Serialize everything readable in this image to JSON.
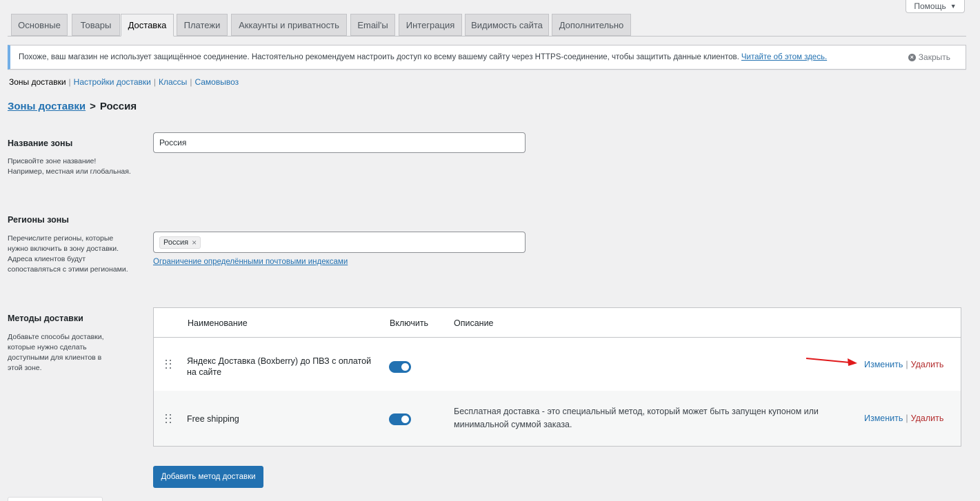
{
  "help": {
    "label": "Помощь",
    "caret": "▼"
  },
  "tabs": [
    {
      "label": "Основные"
    },
    {
      "label": "Товары"
    },
    {
      "label": "Доставка"
    },
    {
      "label": "Платежи"
    },
    {
      "label": "Аккаунты и приватность"
    },
    {
      "label": "Email'ы"
    },
    {
      "label": "Интеграция"
    },
    {
      "label": "Видимость сайта"
    },
    {
      "label": "Дополнительно"
    }
  ],
  "notice": {
    "text": "Похоже, ваш магазин не использует защищённое соединение. Настоятельно рекомендуем настроить доступ ко всему вашему сайту через HTTPS-соединение, чтобы защитить данные клиентов.",
    "link": "Читайте об этом здесь.",
    "close_label": "Закрыть",
    "close_glyph": "×"
  },
  "subnav": {
    "current": "Зоны доставки",
    "links": [
      "Настройки доставки",
      "Классы",
      "Самовывоз"
    ],
    "separator": "|"
  },
  "breadcrumb": {
    "link": "Зоны доставки",
    "separator": ">",
    "current": "Россия"
  },
  "zone_name": {
    "title": "Название зоны",
    "description_1": "Присвойте зоне название!",
    "description_2": "Например, местная или глобальная.",
    "value": "Россия"
  },
  "zone_regions": {
    "title": "Регионы зоны",
    "description": [
      "Перечислите регионы, которые",
      "нужно включить в зону доставки.",
      "Адреса клиентов будут",
      "сопоставляться с этими регионами."
    ],
    "chip": "Россия",
    "chip_remove": "×",
    "postcode_link": "Ограничение определёнными почтовыми индексами"
  },
  "methods": {
    "title": "Методы доставки",
    "description": [
      "Добавьте способы доставки,",
      "которые нужно сделать",
      "доступными для клиентов в",
      "этой зоне."
    ],
    "headers": {
      "name": "Наименование",
      "enabled": "Включить",
      "description": "Описание"
    },
    "rows": [
      {
        "name_1": "Яндекс Доставка (Boxberry) до ПВЗ с оплатой",
        "name_2": "на сайте",
        "enabled": true,
        "description_1": "",
        "description_2": "",
        "edit": "Изменить",
        "bar": "|",
        "delete": "Удалить"
      },
      {
        "name_1": "Free shipping",
        "name_2": "",
        "enabled": true,
        "description_1": "Бесплатная доставка - это специальный метод, который может быть запущен купоном или",
        "description_2": "минимальной суммой заказа.",
        "edit": "Изменить",
        "bar": "|",
        "delete": "Удалить"
      }
    ],
    "add_button": "Добавить метод доставки"
  },
  "colors": {
    "accent": "#2271b1",
    "delete": "#b32d2e",
    "annotation_arrow": "#e0191b",
    "background": "#f0f0f1"
  }
}
